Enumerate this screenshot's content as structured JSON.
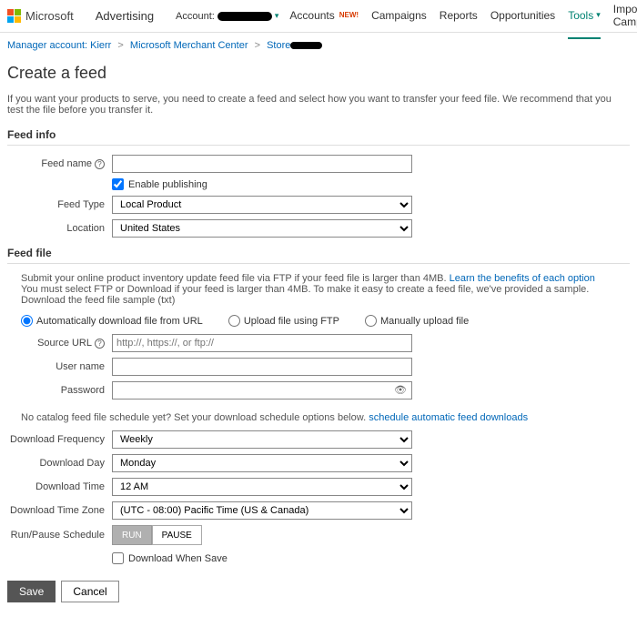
{
  "header": {
    "ms": "Microsoft",
    "brand": "Advertising",
    "accountLabel": "Account:",
    "nav": {
      "accounts": "Accounts",
      "new": "NEW!",
      "campaigns": "Campaigns",
      "reports": "Reports",
      "opportunities": "Opportunities",
      "tools": "Tools",
      "import": "Import Campaigns"
    }
  },
  "breadcrumb": {
    "a": "Manager account: Kierr",
    "b": "Microsoft Merchant Center",
    "c": "Store"
  },
  "page": {
    "title": "Create a feed",
    "intro": "If you want your products to serve, you need to create a feed and select how you want to transfer your feed file. We recommend that you test the file before you transfer it."
  },
  "feedInfo": {
    "section": "Feed info",
    "nameLabel": "Feed name",
    "enablePublishing": "Enable publishing",
    "typeLabel": "Feed Type",
    "typeValue": "Local Product",
    "locationLabel": "Location",
    "locationValue": "United States"
  },
  "feedFile": {
    "section": "Feed file",
    "note1": "Submit your online product inventory update feed file via FTP if your feed file is larger than 4MB. ",
    "noteLink1": "Learn the benefits of each option",
    "note2": "You must select FTP or Download if your feed is larger than 4MB. To make it easy to create a feed file, we've provided a sample. Download the feed file sample (txt)",
    "opt1": "Automatically download file from URL",
    "opt2": "Upload file using FTP",
    "opt3": "Manually upload file",
    "sourceUrlLabel": "Source URL",
    "sourceUrlPlaceholder": "http://, https://, or ftp://",
    "userLabel": "User name",
    "passLabel": "Password"
  },
  "schedule": {
    "note": "No catalog feed file schedule yet? Set your download schedule options below. ",
    "noteLink": "schedule automatic feed downloads",
    "freqLabel": "Download Frequency",
    "freqValue": "Weekly",
    "dayLabel": "Download Day",
    "dayValue": "Monday",
    "timeLabel": "Download Time",
    "timeValue": "12 AM",
    "tzLabel": "Download Time Zone",
    "tzValue": "(UTC - 08:00) Pacific Time (US & Canada)",
    "runPauseLabel": "Run/Pause Schedule",
    "run": "RUN",
    "pause": "PAUSE",
    "downloadWhenSave": "Download When Save"
  },
  "footer": {
    "save": "Save",
    "cancel": "Cancel"
  }
}
